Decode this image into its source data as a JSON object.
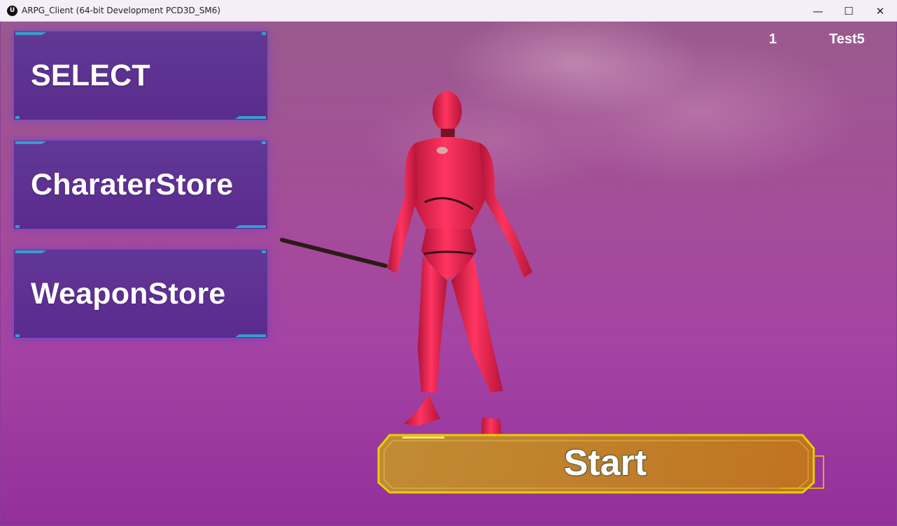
{
  "window": {
    "title": "ARPG_Client (64-bit Development PCD3D_SM6)",
    "app_icon_glyph": "U",
    "controls": {
      "minimize": "—",
      "maximize": "☐",
      "close": "✕"
    }
  },
  "hud": {
    "level": "1",
    "player_name": "Test5"
  },
  "menu": {
    "items": [
      {
        "label": "SELECT"
      },
      {
        "label": "CharaterStore"
      },
      {
        "label": "WeaponStore"
      }
    ]
  },
  "start_button": {
    "label": "Start"
  },
  "colors": {
    "menu_accent": "#35a0c8",
    "menu_fill": "#5a3496",
    "start_border": "#e8d000",
    "start_fill": "#c8901a",
    "character": "#e0204a"
  },
  "icons": {
    "app": "unreal-engine-icon",
    "minimize": "minimize-icon",
    "maximize": "maximize-icon",
    "close": "close-icon"
  }
}
